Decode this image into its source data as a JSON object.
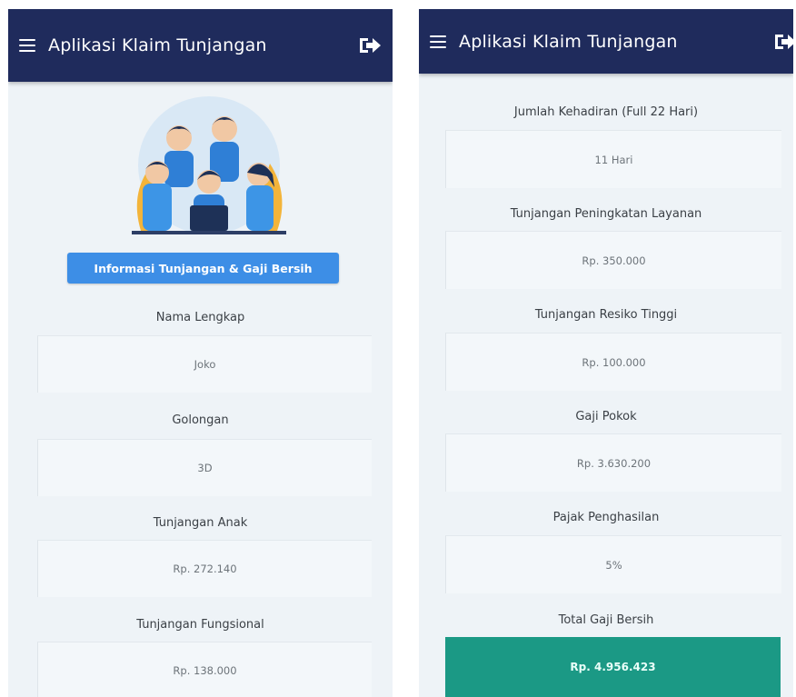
{
  "app": {
    "title": "Aplikasi Klaim Tunjangan",
    "colors": {
      "appbar": "#1f2b5c",
      "accent": "#3d8ee6",
      "total": "#1b9985",
      "background": "#eef3f7"
    },
    "icons": {
      "menu": "hamburger-menu-icon",
      "logout": "logout-icon"
    }
  },
  "left_screen": {
    "info_button_label": "Informasi Tunjangan & Gaji Bersih",
    "fields": [
      {
        "label": "Nama Lengkap",
        "value": "Joko"
      },
      {
        "label": "Golongan",
        "value": "3D"
      },
      {
        "label": "Tunjangan Anak",
        "value": "Rp. 272.140"
      },
      {
        "label": "Tunjangan Fungsional",
        "value": "Rp. 138.000"
      }
    ]
  },
  "right_screen": {
    "fields": [
      {
        "label": "Jumlah Kehadiran (Full 22 Hari)",
        "value": "11 Hari"
      },
      {
        "label": "Tunjangan Peningkatan Layanan",
        "value": "Rp. 350.000"
      },
      {
        "label": "Tunjangan Resiko Tinggi",
        "value": "Rp. 100.000"
      },
      {
        "label": "Gaji Pokok",
        "value": "Rp. 3.630.200"
      },
      {
        "label": "Pajak Penghasilan",
        "value": "5%"
      }
    ],
    "total": {
      "label": "Total Gaji Bersih",
      "value": "Rp. 4.956.423"
    }
  }
}
